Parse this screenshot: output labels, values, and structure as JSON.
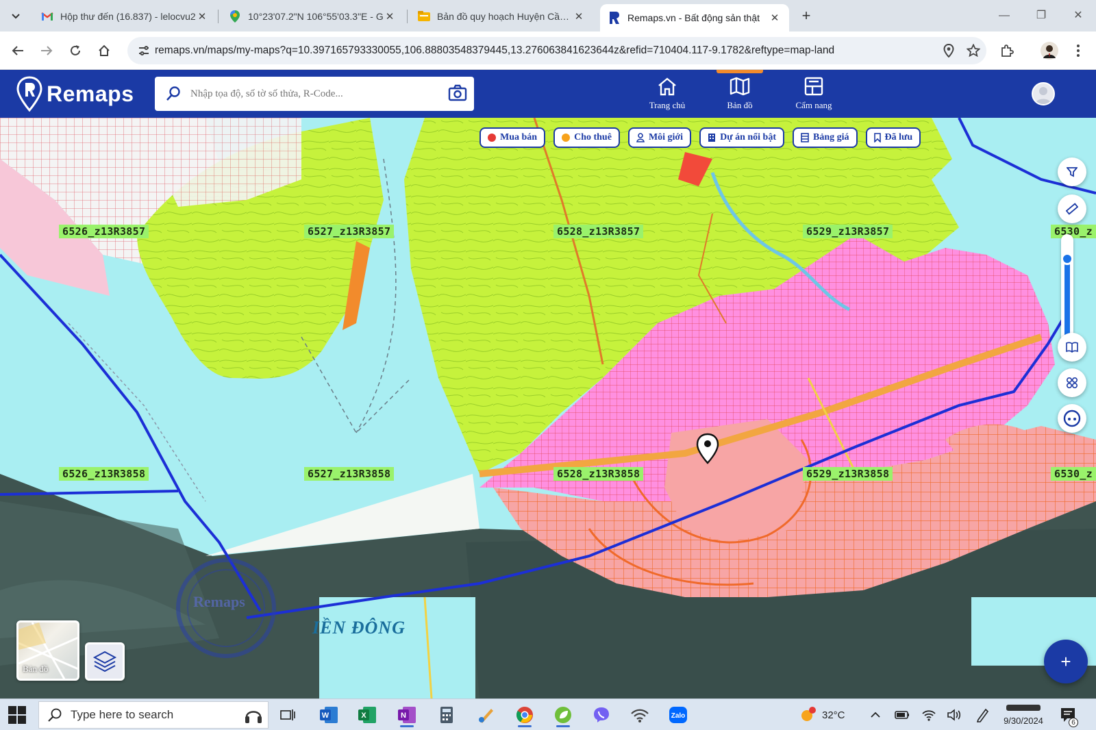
{
  "browser": {
    "tabs": [
      {
        "title": "Hộp thư đến (16.837) - lelocvu2",
        "icon": "gmail-icon"
      },
      {
        "title": "10°23'07.2\"N 106°55'03.3\"E - G",
        "icon": "maps-pin-icon"
      },
      {
        "title": "Bản đồ quy hoạch Huyện Cần G",
        "icon": "folder-icon"
      },
      {
        "title": "Remaps.vn - Bất động sản thật",
        "icon": "remaps-icon"
      }
    ],
    "url": "remaps.vn/maps/my-maps?q=10.397165793330055,106.88803548379445,13.276063841623644z&refid=710404.117-9.1782&reftype=map-land"
  },
  "app": {
    "logo_text": "Remaps",
    "search_placeholder": "Nhập tọa độ, số tờ số thửa, R-Code...",
    "nav": [
      {
        "label": "Trang chủ",
        "icon": "home-icon"
      },
      {
        "label": "Bản đồ",
        "icon": "map-icon",
        "active": true
      },
      {
        "label": "Cẩm nang",
        "icon": "handbook-icon"
      }
    ],
    "brand_color": "#1b3aa5",
    "accent_color": "#f28b2c"
  },
  "map": {
    "filter_chips": [
      {
        "label": "Mua bán",
        "dot_color": "#e53935"
      },
      {
        "label": "Cho thuê",
        "dot_color": "#f7a21b"
      },
      {
        "label": "Môi giới",
        "icon": "person-icon"
      },
      {
        "label": "Dự án nổi bật",
        "icon": "building-icon"
      },
      {
        "label": "Bảng giá",
        "icon": "table-icon"
      },
      {
        "label": "Đã lưu",
        "icon": "bookmark-icon"
      }
    ],
    "sheet_labels": [
      "6526_z13R3857",
      "6527_z13R3857",
      "6528_z13R3857",
      "6529_z13R3857",
      "6530_z",
      "6526_z13R3858",
      "6527_z13R3858",
      "6528_z13R3858",
      "6529_z13R3858",
      "6530_z"
    ],
    "water_label": "IỀN ĐÔNG",
    "watermark_logo": "Remaps",
    "basemap_label": "Bản đồ",
    "zoom_level_fraction": 0.82,
    "add_button": "+"
  },
  "taskbar": {
    "search_placeholder": "Type here to search",
    "weather": "32°C",
    "date": "9/30/2024",
    "notification_count": "6"
  }
}
